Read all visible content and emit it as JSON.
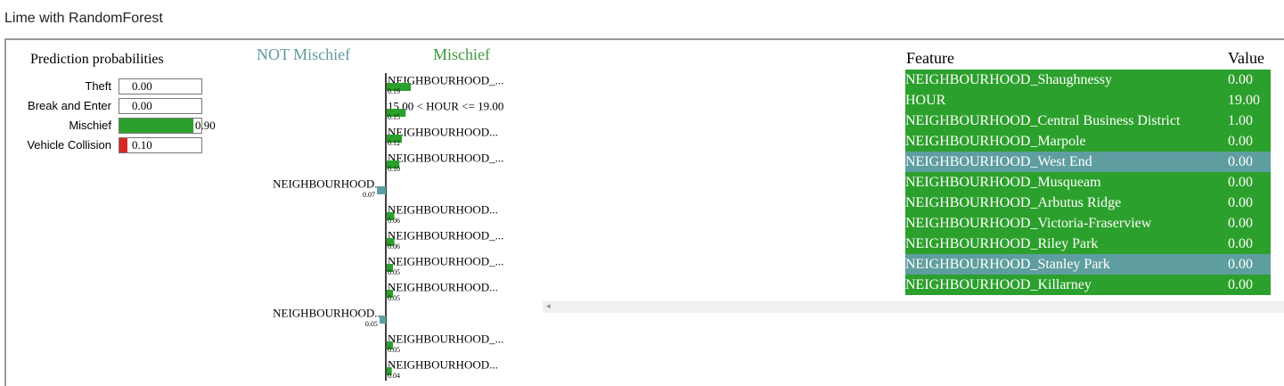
{
  "app": {
    "title": "Lime with RandomForest"
  },
  "colors": {
    "positive": "#2ca02c",
    "negative": "#5f9ea0",
    "danger": "#d62728",
    "border": "#9a9a9a"
  },
  "prediction": {
    "title": "Prediction probabilities",
    "classes": [
      {
        "label": "Theft",
        "value": 0.0,
        "display": "0.00"
      },
      {
        "label": "Break and Enter",
        "value": 0.0,
        "display": "0.00"
      },
      {
        "label": "Mischief",
        "value": 0.9,
        "display": "0.90"
      },
      {
        "label": "Vehicle Collision",
        "value": 0.1,
        "display": "0.10"
      }
    ]
  },
  "chart_data": {
    "type": "bar",
    "orientation": "horizontal",
    "class_labels": {
      "negative": "NOT Mischief",
      "positive": "Mischief"
    },
    "features": [
      {
        "label": "NEIGHBOURHOOD_...",
        "value": 0.19,
        "display": "0.19"
      },
      {
        "label": "15.00 < HOUR <= 19.00",
        "value": 0.15,
        "display": "0.15"
      },
      {
        "label": "NEIGHBOURHOOD...",
        "value": 0.12,
        "display": "0.12"
      },
      {
        "label": "NEIGHBOURHOOD_...",
        "value": 0.1,
        "display": "0.10"
      },
      {
        "label": "NEIGHBOURHOOD...",
        "value": -0.07,
        "display": "0.07"
      },
      {
        "label": "NEIGHBOURHOOD...",
        "value": 0.06,
        "display": "0.06"
      },
      {
        "label": "NEIGHBOURHOOD_...",
        "value": 0.06,
        "display": "0.06"
      },
      {
        "label": "NEIGHBOURHOOD_...",
        "value": 0.05,
        "display": "0.05"
      },
      {
        "label": "NEIGHBOURHOOD...",
        "value": 0.05,
        "display": "0.05"
      },
      {
        "label": "NEIGHBOURHOOD...",
        "value": -0.05,
        "display": "0.05"
      },
      {
        "label": "NEIGHBOURHOOD_...",
        "value": 0.05,
        "display": "0.05"
      },
      {
        "label": "NEIGHBOURHOOD...",
        "value": 0.04,
        "display": "0.04"
      }
    ]
  },
  "feature_table": {
    "headers": {
      "feature": "Feature",
      "value": "Value"
    },
    "rows": [
      {
        "feature": "NEIGHBOURHOOD_Shaughnessy",
        "value": "0.00",
        "sign": "positive"
      },
      {
        "feature": "HOUR",
        "value": "19.00",
        "sign": "positive"
      },
      {
        "feature": "NEIGHBOURHOOD_Central Business District",
        "value": "1.00",
        "sign": "positive"
      },
      {
        "feature": "NEIGHBOURHOOD_Marpole",
        "value": "0.00",
        "sign": "positive"
      },
      {
        "feature": "NEIGHBOURHOOD_West End",
        "value": "0.00",
        "sign": "negative"
      },
      {
        "feature": "NEIGHBOURHOOD_Musqueam",
        "value": "0.00",
        "sign": "positive"
      },
      {
        "feature": "NEIGHBOURHOOD_Arbutus Ridge",
        "value": "0.00",
        "sign": "positive"
      },
      {
        "feature": "NEIGHBOURHOOD_Victoria-Fraserview",
        "value": "0.00",
        "sign": "positive"
      },
      {
        "feature": "NEIGHBOURHOOD_Riley Park",
        "value": "0.00",
        "sign": "positive"
      },
      {
        "feature": "NEIGHBOURHOOD_Stanley Park",
        "value": "0.00",
        "sign": "negative"
      },
      {
        "feature": "NEIGHBOURHOOD_Killarney",
        "value": "0.00",
        "sign": "positive"
      }
    ]
  },
  "scrollbar": {
    "left_arrow": "◂"
  }
}
